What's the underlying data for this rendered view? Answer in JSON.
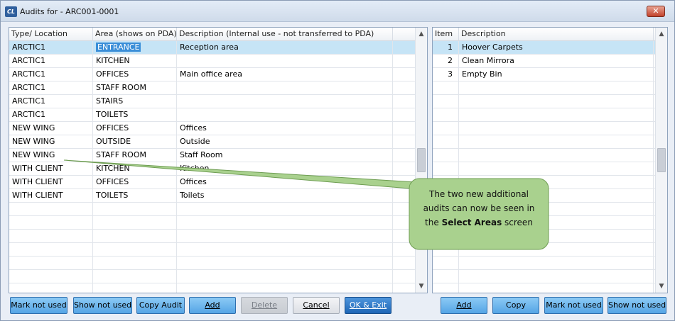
{
  "window": {
    "title": "Audits for - ARC001-0001",
    "app_icon": "CL",
    "close_label": "✕"
  },
  "left_grid": {
    "columns": [
      "Type/ Location",
      "Area (shows on PDA)",
      "Description (Internal use - not transferred to PDA)"
    ],
    "rows": [
      {
        "type": "ARCTIC1",
        "area": "ENTRANCE",
        "description": "Reception area"
      },
      {
        "type": "ARCTIC1",
        "area": "KITCHEN",
        "description": ""
      },
      {
        "type": "ARCTIC1",
        "area": "OFFICES",
        "description": "Main office area"
      },
      {
        "type": "ARCTIC1",
        "area": "STAFF ROOM",
        "description": ""
      },
      {
        "type": "ARCTIC1",
        "area": "STAIRS",
        "description": ""
      },
      {
        "type": "ARCTIC1",
        "area": "TOILETS",
        "description": ""
      },
      {
        "type": "NEW WING",
        "area": "OFFICES",
        "description": "Offices"
      },
      {
        "type": "NEW WING",
        "area": "OUTSIDE",
        "description": "Outside"
      },
      {
        "type": "NEW WING",
        "area": "STAFF ROOM",
        "description": "Staff Room"
      },
      {
        "type": "WITH CLIENT",
        "area": "KITCHEN",
        "description": "Kitchen"
      },
      {
        "type": "WITH CLIENT",
        "area": "OFFICES",
        "description": "Offices"
      },
      {
        "type": "WITH CLIENT",
        "area": "TOILETS",
        "description": "Toilets"
      }
    ],
    "selected_row": 0
  },
  "right_grid": {
    "columns": [
      "Item",
      "Description"
    ],
    "rows": [
      {
        "item": "1",
        "description": "Hoover Carpets"
      },
      {
        "item": "2",
        "description": "Clean Mirrora"
      },
      {
        "item": "3",
        "description": "Empty Bin"
      }
    ],
    "selected_row": 0
  },
  "left_buttons": {
    "mark_not_used": "Mark not used",
    "show_not_used": "Show not used",
    "copy_audit": "Copy Audit",
    "add": "Add",
    "delete": "Delete",
    "cancel": "Cancel",
    "ok_exit": "OK & Exit"
  },
  "right_buttons": {
    "add": "Add",
    "copy": "Copy",
    "mark_not_used": "Mark not used",
    "show_not_used": "Show not used"
  },
  "callout": {
    "line1": "The two new additional",
    "line2": "audits can now be seen in",
    "line3_prefix": "the ",
    "line3_bold": "Select Areas",
    "line3_suffix": " screen"
  },
  "colors": {
    "selection": "#c6e4f6",
    "cell_highlight": "#3a8ed8",
    "callout_fill": "#a9d18e",
    "button_blue": "#6fb6ec"
  }
}
